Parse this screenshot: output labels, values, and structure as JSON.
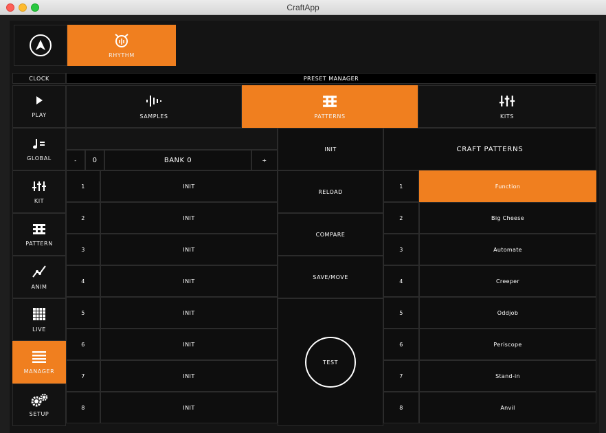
{
  "window": {
    "title": "CraftApp"
  },
  "topbar": {
    "rhythm_label": "RHYTHM"
  },
  "sidebar": {
    "clock_label": "CLOCK",
    "items": [
      {
        "label": "PLAY",
        "icon": "play-icon"
      },
      {
        "label": "GLOBAL",
        "icon": "note-equals-icon"
      },
      {
        "label": "KIT",
        "icon": "sliders-icon"
      },
      {
        "label": "PATTERN",
        "icon": "pattern-icon"
      },
      {
        "label": "ANIM",
        "icon": "anim-line-icon"
      },
      {
        "label": "LIVE",
        "icon": "grid-icon"
      },
      {
        "label": "MANAGER",
        "icon": "list-icon"
      },
      {
        "label": "SETUP",
        "icon": "gears-icon"
      }
    ],
    "active": "MANAGER"
  },
  "preset_manager": {
    "title": "PRESET MANAGER",
    "tabs": [
      {
        "label": "SAMPLES",
        "icon": "samples-waveform-icon"
      },
      {
        "label": "PATTERNS",
        "icon": "pattern-icon"
      },
      {
        "label": "KITS",
        "icon": "sliders-icon"
      }
    ],
    "active_tab": "PATTERNS"
  },
  "bank": {
    "minus": "-",
    "value": "0",
    "name": "BANK 0",
    "plus": "+"
  },
  "user_slots": [
    {
      "num": "1",
      "name": "INIT"
    },
    {
      "num": "2",
      "name": "INIT"
    },
    {
      "num": "3",
      "name": "INIT"
    },
    {
      "num": "4",
      "name": "INIT"
    },
    {
      "num": "5",
      "name": "INIT"
    },
    {
      "num": "6",
      "name": "INIT"
    },
    {
      "num": "7",
      "name": "INIT"
    },
    {
      "num": "8",
      "name": "INIT"
    }
  ],
  "actions": {
    "init": "INIT",
    "reload": "RELOAD",
    "compare": "COMPARE",
    "save_move": "SAVE/MOVE",
    "test": "TEST"
  },
  "factory": {
    "title": "CRAFT PATTERNS",
    "items": [
      {
        "num": "1",
        "name": "Function"
      },
      {
        "num": "2",
        "name": "Big Cheese"
      },
      {
        "num": "3",
        "name": "Automate"
      },
      {
        "num": "4",
        "name": "Creeper"
      },
      {
        "num": "5",
        "name": "Oddjob"
      },
      {
        "num": "6",
        "name": "Periscope"
      },
      {
        "num": "7",
        "name": "Stand-in"
      },
      {
        "num": "8",
        "name": "Anvil"
      }
    ],
    "selected": "Function"
  },
  "colors": {
    "accent": "#f07f1f",
    "background": "#141414",
    "tile": "#121212"
  }
}
